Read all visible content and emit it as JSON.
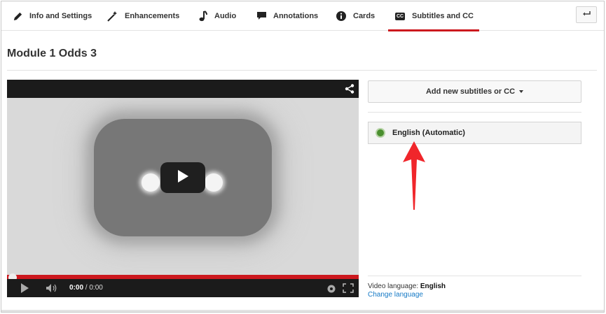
{
  "tabs": [
    {
      "label": "Info and Settings",
      "icon": "pencil-icon"
    },
    {
      "label": "Enhancements",
      "icon": "magic-wand-icon"
    },
    {
      "label": "Audio",
      "icon": "music-note-icon"
    },
    {
      "label": "Annotations",
      "icon": "speech-bubble-icon"
    },
    {
      "label": "Cards",
      "icon": "info-circle-icon"
    },
    {
      "label": "Subtitles and CC",
      "icon": "cc-icon",
      "active": true
    }
  ],
  "cc_badge": "CC",
  "back_button_icon": "back-arrow-icon",
  "page_title": "Module 1 Odds 3",
  "player": {
    "current_time": "0:00",
    "separator": " / ",
    "duration": "0:00",
    "progress": 0
  },
  "subtitles": {
    "add_button_label": "Add new subtitles or CC",
    "tracks": [
      {
        "label": "English (Automatic)",
        "status_color": "#4a8f2e"
      }
    ],
    "video_language_label": "Video language:",
    "video_language_value": "English",
    "change_language_link": "Change language"
  },
  "colors": {
    "accent": "#cc181e",
    "link": "#167ac6",
    "annotation_arrow": "#f0262b"
  }
}
